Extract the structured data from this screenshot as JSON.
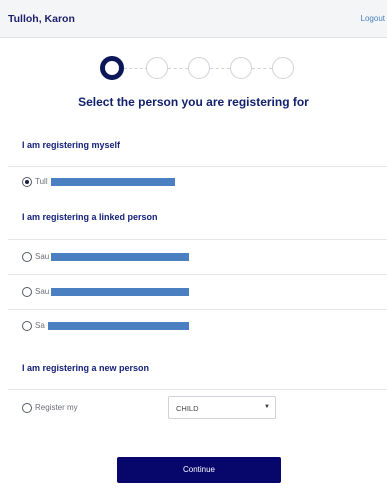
{
  "header": {
    "user_name": "Tulloh, Karon",
    "logout_label": "Logout"
  },
  "stepper": {
    "total_steps": 5,
    "current_step": 1
  },
  "page_title": "Select the person you are registering for",
  "sections": {
    "myself": {
      "title": "I am registering myself",
      "option": {
        "label_prefix": "Tull",
        "selected": true
      }
    },
    "linked": {
      "title": "I am registering a linked person",
      "options": [
        {
          "label_prefix": "Sau",
          "selected": false
        },
        {
          "label_prefix": "Sau",
          "selected": false
        },
        {
          "label_prefix": "Sa",
          "selected": false
        }
      ]
    },
    "new_person": {
      "title": "I am registering a new person",
      "option": {
        "label": "Register my",
        "selected": false
      },
      "select": {
        "value": "CHILD"
      }
    }
  },
  "continue_label": "Continue",
  "colors": {
    "primary": "#06066b",
    "heading": "#12216b",
    "redaction": "#4a7fc1",
    "link": "#4a7fc1"
  }
}
